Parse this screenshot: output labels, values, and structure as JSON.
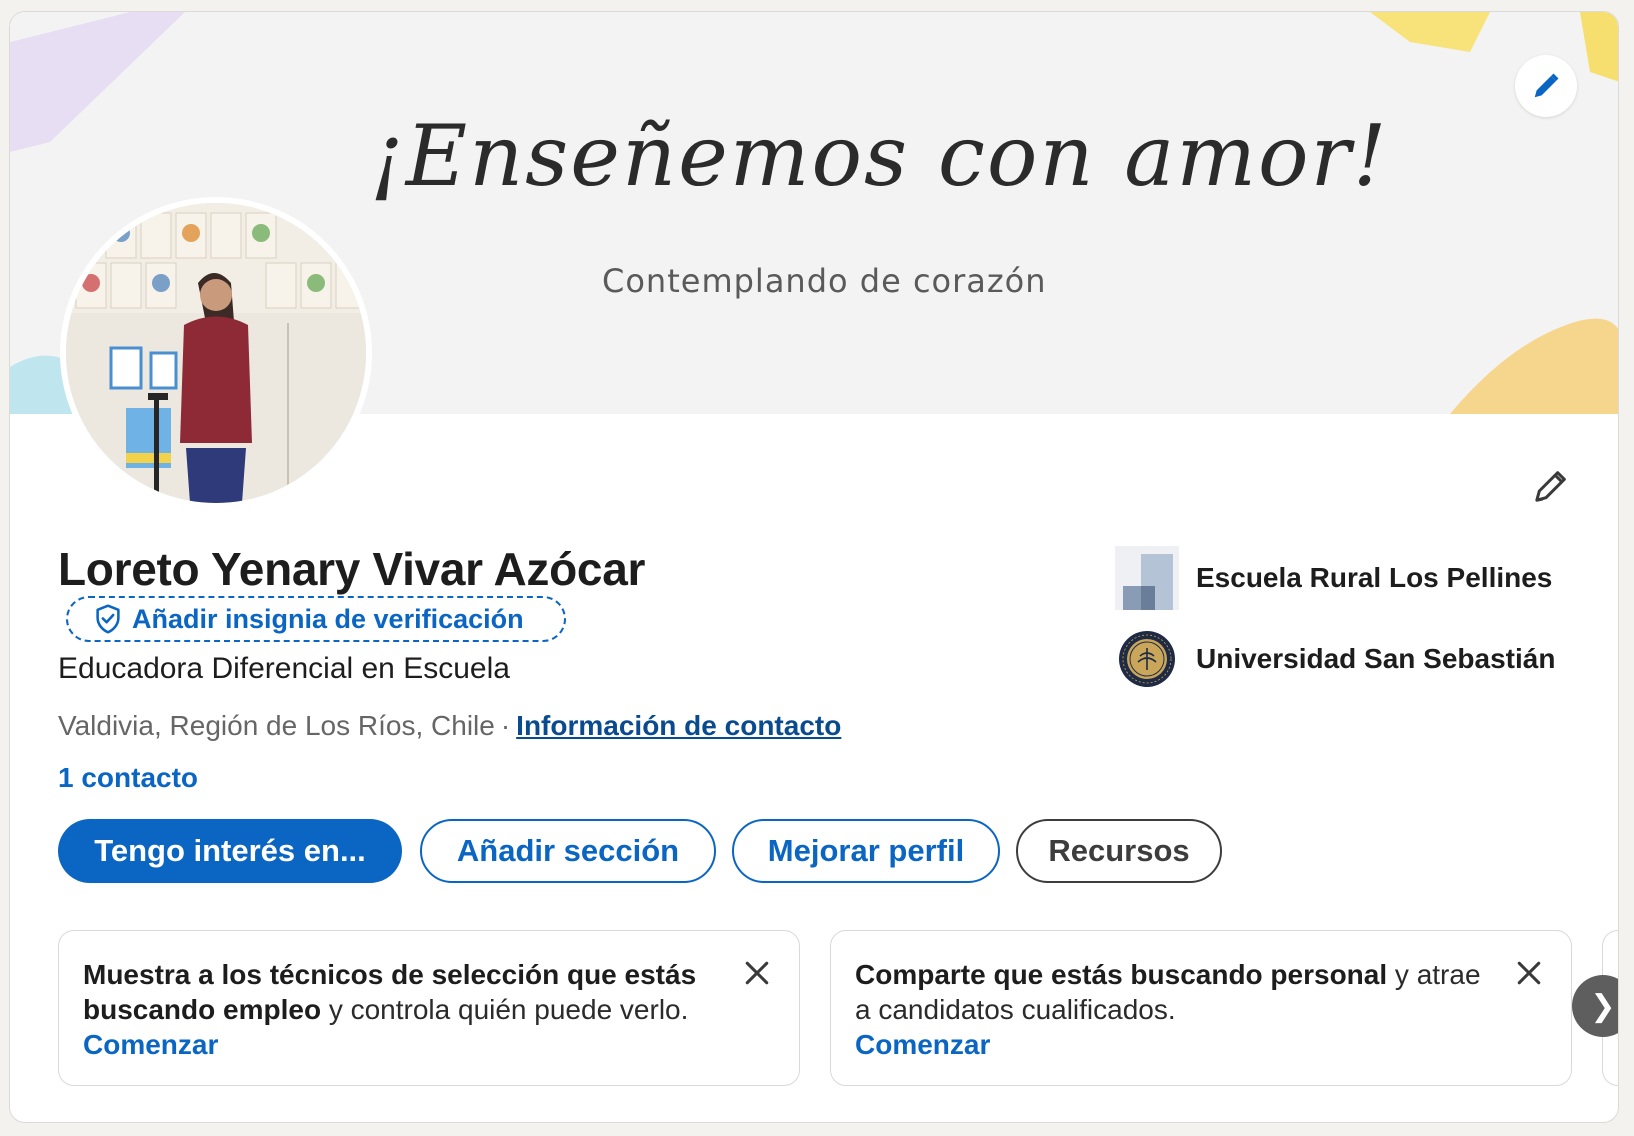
{
  "banner": {
    "headline": "¡Enseñemos con amor!",
    "subtext": "Contemplando de corazón",
    "edit_icon": "pencil-icon"
  },
  "profile": {
    "name": "Loreto Yenary Vivar Azócar",
    "verify_label": "Añadir insignia de verificación",
    "verify_icon": "shield-check-icon",
    "headline": "Educadora Diferencial en Escuela",
    "location": "Valdivia, Región de Los Ríos, Chile",
    "separator": "·",
    "contact_info_link": "Información de contacto",
    "connections": "1 contacto",
    "edit_icon": "pencil-icon"
  },
  "organizations": [
    {
      "name": "Escuela Rural Los Pellines",
      "logo": "company-logo-placeholder"
    },
    {
      "name": "Universidad San Sebastián",
      "logo": "university-seal-logo"
    }
  ],
  "actions": {
    "open_to": "Tengo interés en...",
    "add_section": "Añadir sección",
    "enhance_profile": "Mejorar perfil",
    "resources": "Recursos"
  },
  "promos": [
    {
      "bold": "Muestra a los técnicos de selección que estás buscando empleo",
      "rest": " y controla quién puede verlo.",
      "cta": "Comenzar",
      "close_icon": "close-icon"
    },
    {
      "bold": "Comparte que estás buscando personal",
      "rest": " y atrae a candidatos cualificados.",
      "cta": "Comenzar",
      "close_icon": "close-icon"
    }
  ],
  "carousel": {
    "next_icon": "chevron-right-icon",
    "next_glyph": "❯"
  },
  "colors": {
    "accent": "#0a66c2",
    "page_background": "#f4f2ee",
    "card_background": "#ffffff",
    "banner_background": "#f3f3f3",
    "carousel_button": "#5e5e5e"
  }
}
